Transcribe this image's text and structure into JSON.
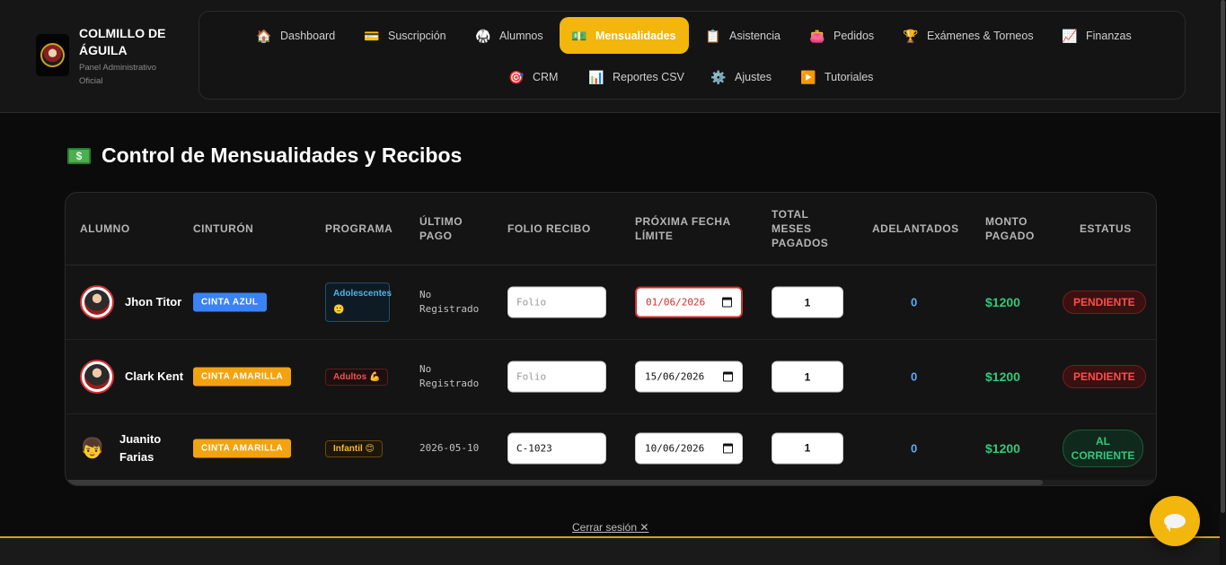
{
  "brand": {
    "title": "COLMILLO DE ÁGUILA",
    "subtitle": "Panel Administrativo Oficial"
  },
  "nav": {
    "items": [
      {
        "label": "Dashboard",
        "icon": "🏠"
      },
      {
        "label": "Suscripción",
        "icon": "💳"
      },
      {
        "label": "Alumnos",
        "icon": "🥋"
      },
      {
        "label": "Mensualidades",
        "icon": "💵"
      },
      {
        "label": "Asistencia",
        "icon": "📋"
      },
      {
        "label": "Pedidos",
        "icon": "👛"
      },
      {
        "label": "Exámenes & Torneos",
        "icon": "🏆"
      },
      {
        "label": "Finanzas",
        "icon": "📈"
      },
      {
        "label": "CRM",
        "icon": "🎯"
      },
      {
        "label": "Reportes CSV",
        "icon": "📊"
      },
      {
        "label": "Ajustes",
        "icon": "⚙️"
      },
      {
        "label": "Tutoriales",
        "icon": "▶️"
      }
    ],
    "active": "Mensualidades",
    "accent_color": "#f2b60c"
  },
  "page": {
    "title": "Control de Mensualidades y Recibos",
    "title_icon": "💵"
  },
  "table": {
    "headers": {
      "alumno": "ALUMNO",
      "cinturon": "CINTURÓN",
      "programa": "PROGRAMA",
      "ultimo_pago": "ÚLTIMO PAGO",
      "folio": "FOLIO RECIBO",
      "proxima": "PRÓXIMA FECHA LÍMITE",
      "total": "TOTAL MESES PAGADOS",
      "adelantados": "ADELANTADOS",
      "monto": "MONTO PAGADO",
      "estatus": "ESTATUS"
    },
    "rows": [
      {
        "name": "Jhon Titor",
        "avatar": "photo",
        "belt": "CINTA AZUL",
        "program": "Adolescentes 🙂",
        "last_payment": "No Registrado",
        "folio_value": "",
        "folio_placeholder": "Folio",
        "next_due": "01/06/2026",
        "months_paid": "1",
        "advanced": "0",
        "amount": "$1200",
        "status": "PENDIENTE"
      },
      {
        "name": "Clark Kent",
        "avatar": "photo",
        "belt": "CINTA AMARILLA",
        "program": "Adultos 💪",
        "last_payment": "No Registrado",
        "folio_value": "",
        "folio_placeholder": "Folio",
        "next_due": "15/06/2026",
        "months_paid": "1",
        "advanced": "0",
        "amount": "$1200",
        "status": "PENDIENTE"
      },
      {
        "name": "Juanito Farias",
        "avatar": "👦",
        "belt": "CINTA AMARILLA",
        "program": "Infantil 😊",
        "last_payment": "2026-05-10",
        "folio_value": "C-1023",
        "folio_placeholder": "Folio",
        "next_due": "10/06/2026",
        "months_paid": "1",
        "advanced": "0",
        "amount": "$1200",
        "status": "AL CORRIENTE"
      }
    ]
  },
  "footer": {
    "logout": "Cerrar sesión ✕"
  },
  "colors": {
    "pending": "#ff4d4d",
    "ok": "#34c77b",
    "belt_blue": "#3b82f6",
    "belt_yellow": "#f2a30f"
  }
}
